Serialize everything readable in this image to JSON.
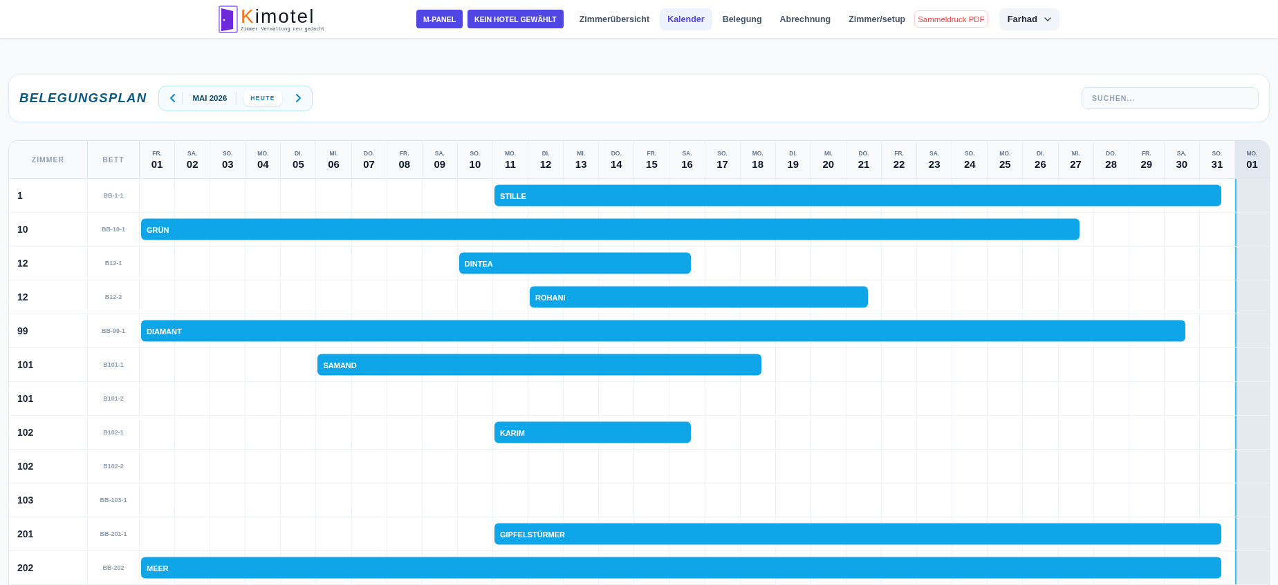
{
  "header": {
    "logo": {
      "initial": "K",
      "rest": "imotel",
      "tagline": "Zimmer Verwaltung neu gedacht"
    },
    "buttons": [
      "M-PANEL",
      "KEIN HOTEL GEWÄHLT"
    ],
    "nav": [
      {
        "label": "Zimmerübersicht",
        "selected": false
      },
      {
        "label": "Kalender",
        "selected": true
      },
      {
        "label": "Belegung",
        "selected": false
      },
      {
        "label": "Abrechnung",
        "selected": false
      },
      {
        "label": "Zimmer/setup",
        "selected": false
      }
    ],
    "print_button": "Sammeldruck PDF",
    "user": "Farhad"
  },
  "toolbar": {
    "title": "BELEGUNGSPLAN",
    "month": "MAI 2026",
    "today_button": "HEUTE",
    "search": {
      "placeholder": "SUCHEN..."
    }
  },
  "calendar": {
    "columns": [
      "ZIMMER",
      "BETT"
    ],
    "days": [
      {
        "weekday": "FR.",
        "day": "01",
        "next_month": false
      },
      {
        "weekday": "SA.",
        "day": "02",
        "next_month": false
      },
      {
        "weekday": "SO.",
        "day": "03",
        "next_month": false
      },
      {
        "weekday": "MO.",
        "day": "04",
        "next_month": false
      },
      {
        "weekday": "DI.",
        "day": "05",
        "next_month": false
      },
      {
        "weekday": "MI.",
        "day": "06",
        "next_month": false
      },
      {
        "weekday": "DO.",
        "day": "07",
        "next_month": false
      },
      {
        "weekday": "FR.",
        "day": "08",
        "next_month": false
      },
      {
        "weekday": "SA.",
        "day": "09",
        "next_month": false
      },
      {
        "weekday": "SO.",
        "day": "10",
        "next_month": false
      },
      {
        "weekday": "MO.",
        "day": "11",
        "next_month": false
      },
      {
        "weekday": "DI.",
        "day": "12",
        "next_month": false
      },
      {
        "weekday": "MI.",
        "day": "13",
        "next_month": false
      },
      {
        "weekday": "DO.",
        "day": "14",
        "next_month": false
      },
      {
        "weekday": "FR.",
        "day": "15",
        "next_month": false
      },
      {
        "weekday": "SA.",
        "day": "16",
        "next_month": false
      },
      {
        "weekday": "SO.",
        "day": "17",
        "next_month": false
      },
      {
        "weekday": "MO.",
        "day": "18",
        "next_month": false
      },
      {
        "weekday": "DI.",
        "day": "19",
        "next_month": false
      },
      {
        "weekday": "MI.",
        "day": "20",
        "next_month": false
      },
      {
        "weekday": "DO.",
        "day": "21",
        "next_month": false
      },
      {
        "weekday": "FR.",
        "day": "22",
        "next_month": false
      },
      {
        "weekday": "SA.",
        "day": "23",
        "next_month": false
      },
      {
        "weekday": "SO.",
        "day": "24",
        "next_month": false
      },
      {
        "weekday": "MO.",
        "day": "25",
        "next_month": false
      },
      {
        "weekday": "DI.",
        "day": "26",
        "next_month": false
      },
      {
        "weekday": "MI.",
        "day": "27",
        "next_month": false
      },
      {
        "weekday": "DO.",
        "day": "28",
        "next_month": false
      },
      {
        "weekday": "FR.",
        "day": "29",
        "next_month": false
      },
      {
        "weekday": "SA.",
        "day": "30",
        "next_month": false
      },
      {
        "weekday": "SO.",
        "day": "31",
        "next_month": false
      },
      {
        "weekday": "MO.",
        "day": "01",
        "next_month": true
      }
    ],
    "rows": [
      {
        "room": "1",
        "bed": "BB-1-1",
        "timeline": [
          {
            "kind": "free"
          },
          {
            "kind": "free"
          },
          {
            "kind": "free"
          },
          {
            "kind": "free"
          },
          {
            "kind": "free"
          },
          {
            "kind": "free"
          },
          {
            "kind": "free"
          },
          {
            "kind": "free"
          },
          {
            "kind": "free"
          },
          {
            "kind": "free"
          },
          {
            "kind": "arrival",
            "guest": "STILLE"
          },
          {
            "kind": "stay"
          },
          {
            "kind": "stay"
          },
          {
            "kind": "stay"
          },
          {
            "kind": "stay"
          },
          {
            "kind": "stay"
          },
          {
            "kind": "stay"
          },
          {
            "kind": "stay"
          },
          {
            "kind": "stay"
          },
          {
            "kind": "stay"
          },
          {
            "kind": "stay"
          },
          {
            "kind": "stay"
          },
          {
            "kind": "stay"
          },
          {
            "kind": "stay"
          },
          {
            "kind": "stay"
          },
          {
            "kind": "stay"
          },
          {
            "kind": "stay"
          },
          {
            "kind": "stay"
          },
          {
            "kind": "stay"
          },
          {
            "kind": "stay"
          },
          {
            "kind": "departure"
          },
          {
            "kind": "free"
          }
        ]
      },
      {
        "room": "10",
        "bed": "BB-10-1",
        "timeline": [
          {
            "kind": "arrival",
            "guest": "GRÜN"
          },
          {
            "kind": "stay"
          },
          {
            "kind": "stay"
          },
          {
            "kind": "stay"
          },
          {
            "kind": "stay"
          },
          {
            "kind": "stay"
          },
          {
            "kind": "stay"
          },
          {
            "kind": "stay"
          },
          {
            "kind": "stay"
          },
          {
            "kind": "stay"
          },
          {
            "kind": "stay"
          },
          {
            "kind": "stay"
          },
          {
            "kind": "stay"
          },
          {
            "kind": "stay"
          },
          {
            "kind": "stay"
          },
          {
            "kind": "stay"
          },
          {
            "kind": "stay"
          },
          {
            "kind": "stay"
          },
          {
            "kind": "stay"
          },
          {
            "kind": "stay"
          },
          {
            "kind": "stay"
          },
          {
            "kind": "stay"
          },
          {
            "kind": "stay"
          },
          {
            "kind": "stay"
          },
          {
            "kind": "stay"
          },
          {
            "kind": "stay"
          },
          {
            "kind": "departure"
          },
          {
            "kind": "free"
          },
          {
            "kind": "free"
          },
          {
            "kind": "free"
          },
          {
            "kind": "free"
          },
          {
            "kind": "free"
          }
        ]
      },
      {
        "room": "12",
        "bed": "B12-1",
        "timeline": [
          {
            "kind": "free"
          },
          {
            "kind": "free"
          },
          {
            "kind": "free"
          },
          {
            "kind": "free"
          },
          {
            "kind": "free"
          },
          {
            "kind": "free"
          },
          {
            "kind": "free"
          },
          {
            "kind": "free"
          },
          {
            "kind": "free"
          },
          {
            "kind": "arrival",
            "guest": "DINTEA"
          },
          {
            "kind": "stay"
          },
          {
            "kind": "stay"
          },
          {
            "kind": "stay"
          },
          {
            "kind": "stay"
          },
          {
            "kind": "stay"
          },
          {
            "kind": "departure"
          },
          {
            "kind": "free"
          },
          {
            "kind": "free"
          },
          {
            "kind": "free"
          },
          {
            "kind": "free"
          },
          {
            "kind": "free"
          },
          {
            "kind": "free"
          },
          {
            "kind": "free"
          },
          {
            "kind": "free"
          },
          {
            "kind": "free"
          },
          {
            "kind": "free"
          },
          {
            "kind": "free"
          },
          {
            "kind": "free"
          },
          {
            "kind": "free"
          },
          {
            "kind": "free"
          },
          {
            "kind": "free"
          },
          {
            "kind": "free"
          }
        ]
      },
      {
        "room": "12",
        "bed": "B12-2",
        "timeline": [
          {
            "kind": "free"
          },
          {
            "kind": "free"
          },
          {
            "kind": "free"
          },
          {
            "kind": "free"
          },
          {
            "kind": "free"
          },
          {
            "kind": "free"
          },
          {
            "kind": "free"
          },
          {
            "kind": "free"
          },
          {
            "kind": "free"
          },
          {
            "kind": "free"
          },
          {
            "kind": "free"
          },
          {
            "kind": "arrival",
            "guest": "ROHANI"
          },
          {
            "kind": "stay"
          },
          {
            "kind": "stay"
          },
          {
            "kind": "stay"
          },
          {
            "kind": "stay"
          },
          {
            "kind": "stay"
          },
          {
            "kind": "stay"
          },
          {
            "kind": "stay"
          },
          {
            "kind": "stay"
          },
          {
            "kind": "departure"
          },
          {
            "kind": "free"
          },
          {
            "kind": "free"
          },
          {
            "kind": "free"
          },
          {
            "kind": "free"
          },
          {
            "kind": "free"
          },
          {
            "kind": "free"
          },
          {
            "kind": "free"
          },
          {
            "kind": "free"
          },
          {
            "kind": "free"
          },
          {
            "kind": "free"
          },
          {
            "kind": "free"
          }
        ]
      },
      {
        "room": "99",
        "bed": "BB-99-1",
        "timeline": [
          {
            "kind": "arrival",
            "guest": "DIAMANT"
          },
          {
            "kind": "stay"
          },
          {
            "kind": "stay"
          },
          {
            "kind": "stay"
          },
          {
            "kind": "stay"
          },
          {
            "kind": "stay"
          },
          {
            "kind": "stay"
          },
          {
            "kind": "stay"
          },
          {
            "kind": "stay"
          },
          {
            "kind": "stay"
          },
          {
            "kind": "stay"
          },
          {
            "kind": "stay"
          },
          {
            "kind": "stay"
          },
          {
            "kind": "stay"
          },
          {
            "kind": "stay"
          },
          {
            "kind": "stay"
          },
          {
            "kind": "stay"
          },
          {
            "kind": "stay"
          },
          {
            "kind": "stay"
          },
          {
            "kind": "stay"
          },
          {
            "kind": "stay"
          },
          {
            "kind": "stay"
          },
          {
            "kind": "stay"
          },
          {
            "kind": "stay"
          },
          {
            "kind": "stay"
          },
          {
            "kind": "stay"
          },
          {
            "kind": "stay"
          },
          {
            "kind": "stay"
          },
          {
            "kind": "stay"
          },
          {
            "kind": "departure"
          },
          {
            "kind": "free"
          },
          {
            "kind": "free"
          }
        ]
      },
      {
        "room": "101",
        "bed": "B101-1",
        "timeline": [
          {
            "kind": "free"
          },
          {
            "kind": "free"
          },
          {
            "kind": "free"
          },
          {
            "kind": "free"
          },
          {
            "kind": "free"
          },
          {
            "kind": "arrival",
            "guest": "SAMAND"
          },
          {
            "kind": "stay"
          },
          {
            "kind": "stay"
          },
          {
            "kind": "stay"
          },
          {
            "kind": "stay"
          },
          {
            "kind": "stay"
          },
          {
            "kind": "stay"
          },
          {
            "kind": "stay"
          },
          {
            "kind": "stay"
          },
          {
            "kind": "stay"
          },
          {
            "kind": "stay"
          },
          {
            "kind": "stay"
          },
          {
            "kind": "departure"
          },
          {
            "kind": "free"
          },
          {
            "kind": "free"
          },
          {
            "kind": "free"
          },
          {
            "kind": "free"
          },
          {
            "kind": "free"
          },
          {
            "kind": "free"
          },
          {
            "kind": "free"
          },
          {
            "kind": "free"
          },
          {
            "kind": "free"
          },
          {
            "kind": "free"
          },
          {
            "kind": "free"
          },
          {
            "kind": "free"
          },
          {
            "kind": "free"
          },
          {
            "kind": "free"
          }
        ]
      },
      {
        "room": "101",
        "bed": "B101-2",
        "timeline": [
          {
            "kind": "free"
          },
          {
            "kind": "free"
          },
          {
            "kind": "free"
          },
          {
            "kind": "free"
          },
          {
            "kind": "free"
          },
          {
            "kind": "free"
          },
          {
            "kind": "free"
          },
          {
            "kind": "free"
          },
          {
            "kind": "free"
          },
          {
            "kind": "free"
          },
          {
            "kind": "free"
          },
          {
            "kind": "free"
          },
          {
            "kind": "free"
          },
          {
            "kind": "free"
          },
          {
            "kind": "free"
          },
          {
            "kind": "free"
          },
          {
            "kind": "free"
          },
          {
            "kind": "free"
          },
          {
            "kind": "free"
          },
          {
            "kind": "free"
          },
          {
            "kind": "free"
          },
          {
            "kind": "free"
          },
          {
            "kind": "free"
          },
          {
            "kind": "free"
          },
          {
            "kind": "free"
          },
          {
            "kind": "free"
          },
          {
            "kind": "free"
          },
          {
            "kind": "free"
          },
          {
            "kind": "free"
          },
          {
            "kind": "free"
          },
          {
            "kind": "free"
          },
          {
            "kind": "free"
          }
        ]
      },
      {
        "room": "102",
        "bed": "B102-1",
        "timeline": [
          {
            "kind": "free"
          },
          {
            "kind": "free"
          },
          {
            "kind": "free"
          },
          {
            "kind": "free"
          },
          {
            "kind": "free"
          },
          {
            "kind": "free"
          },
          {
            "kind": "free"
          },
          {
            "kind": "free"
          },
          {
            "kind": "free"
          },
          {
            "kind": "free"
          },
          {
            "kind": "arrival",
            "guest": "KARIM"
          },
          {
            "kind": "stay"
          },
          {
            "kind": "stay"
          },
          {
            "kind": "stay"
          },
          {
            "kind": "stay"
          },
          {
            "kind": "departure"
          },
          {
            "kind": "free"
          },
          {
            "kind": "free"
          },
          {
            "kind": "free"
          },
          {
            "kind": "free"
          },
          {
            "kind": "free"
          },
          {
            "kind": "free"
          },
          {
            "kind": "free"
          },
          {
            "kind": "free"
          },
          {
            "kind": "free"
          },
          {
            "kind": "free"
          },
          {
            "kind": "free"
          },
          {
            "kind": "free"
          },
          {
            "kind": "free"
          },
          {
            "kind": "free"
          },
          {
            "kind": "free"
          },
          {
            "kind": "free"
          }
        ]
      },
      {
        "room": "102",
        "bed": "B102-2",
        "timeline": [
          {
            "kind": "free"
          },
          {
            "kind": "free"
          },
          {
            "kind": "free"
          },
          {
            "kind": "free"
          },
          {
            "kind": "free"
          },
          {
            "kind": "free"
          },
          {
            "kind": "free"
          },
          {
            "kind": "free"
          },
          {
            "kind": "free"
          },
          {
            "kind": "free"
          },
          {
            "kind": "free"
          },
          {
            "kind": "free"
          },
          {
            "kind": "free"
          },
          {
            "kind": "free"
          },
          {
            "kind": "free"
          },
          {
            "kind": "free"
          },
          {
            "kind": "free"
          },
          {
            "kind": "free"
          },
          {
            "kind": "free"
          },
          {
            "kind": "free"
          },
          {
            "kind": "free"
          },
          {
            "kind": "free"
          },
          {
            "kind": "free"
          },
          {
            "kind": "free"
          },
          {
            "kind": "free"
          },
          {
            "kind": "free"
          },
          {
            "kind": "free"
          },
          {
            "kind": "free"
          },
          {
            "kind": "free"
          },
          {
            "kind": "free"
          },
          {
            "kind": "free"
          },
          {
            "kind": "free"
          }
        ]
      },
      {
        "room": "103",
        "bed": "BB-103-1",
        "timeline": [
          {
            "kind": "free"
          },
          {
            "kind": "free"
          },
          {
            "kind": "free"
          },
          {
            "kind": "free"
          },
          {
            "kind": "free"
          },
          {
            "kind": "free"
          },
          {
            "kind": "free"
          },
          {
            "kind": "free"
          },
          {
            "kind": "free"
          },
          {
            "kind": "free"
          },
          {
            "kind": "free"
          },
          {
            "kind": "free"
          },
          {
            "kind": "free"
          },
          {
            "kind": "free"
          },
          {
            "kind": "free"
          },
          {
            "kind": "free"
          },
          {
            "kind": "free"
          },
          {
            "kind": "free"
          },
          {
            "kind": "free"
          },
          {
            "kind": "free"
          },
          {
            "kind": "free"
          },
          {
            "kind": "free"
          },
          {
            "kind": "free"
          },
          {
            "kind": "free"
          },
          {
            "kind": "free"
          },
          {
            "kind": "free"
          },
          {
            "kind": "free"
          },
          {
            "kind": "free"
          },
          {
            "kind": "free"
          },
          {
            "kind": "free"
          },
          {
            "kind": "free"
          },
          {
            "kind": "free"
          }
        ]
      },
      {
        "room": "201",
        "bed": "BB-201-1",
        "timeline": [
          {
            "kind": "free"
          },
          {
            "kind": "free"
          },
          {
            "kind": "free"
          },
          {
            "kind": "free"
          },
          {
            "kind": "free"
          },
          {
            "kind": "free"
          },
          {
            "kind": "free"
          },
          {
            "kind": "free"
          },
          {
            "kind": "free"
          },
          {
            "kind": "free"
          },
          {
            "kind": "arrival",
            "guest": "GIPFELSTÜRMER"
          },
          {
            "kind": "stay"
          },
          {
            "kind": "stay"
          },
          {
            "kind": "stay"
          },
          {
            "kind": "stay"
          },
          {
            "kind": "stay"
          },
          {
            "kind": "stay"
          },
          {
            "kind": "stay"
          },
          {
            "kind": "stay"
          },
          {
            "kind": "stay"
          },
          {
            "kind": "stay"
          },
          {
            "kind": "stay"
          },
          {
            "kind": "stay"
          },
          {
            "kind": "stay"
          },
          {
            "kind": "stay"
          },
          {
            "kind": "stay"
          },
          {
            "kind": "stay"
          },
          {
            "kind": "stay"
          },
          {
            "kind": "stay"
          },
          {
            "kind": "stay"
          },
          {
            "kind": "departure"
          },
          {
            "kind": "free"
          }
        ]
      },
      {
        "room": "202",
        "bed": "BB-202",
        "timeline": [
          {
            "kind": "arrival",
            "guest": "MEER"
          },
          {
            "kind": "stay"
          },
          {
            "kind": "stay"
          },
          {
            "kind": "stay"
          },
          {
            "kind": "stay"
          },
          {
            "kind": "stay"
          },
          {
            "kind": "stay"
          },
          {
            "kind": "stay"
          },
          {
            "kind": "stay"
          },
          {
            "kind": "stay"
          },
          {
            "kind": "stay"
          },
          {
            "kind": "stay"
          },
          {
            "kind": "stay"
          },
          {
            "kind": "stay"
          },
          {
            "kind": "stay"
          },
          {
            "kind": "stay"
          },
          {
            "kind": "stay"
          },
          {
            "kind": "stay"
          },
          {
            "kind": "stay"
          },
          {
            "kind": "stay"
          },
          {
            "kind": "stay"
          },
          {
            "kind": "stay"
          },
          {
            "kind": "stay"
          },
          {
            "kind": "stay"
          },
          {
            "kind": "stay"
          },
          {
            "kind": "stay"
          },
          {
            "kind": "stay"
          },
          {
            "kind": "stay"
          },
          {
            "kind": "stay"
          },
          {
            "kind": "stay"
          },
          {
            "kind": "departure"
          },
          {
            "kind": "free"
          }
        ]
      }
    ]
  }
}
